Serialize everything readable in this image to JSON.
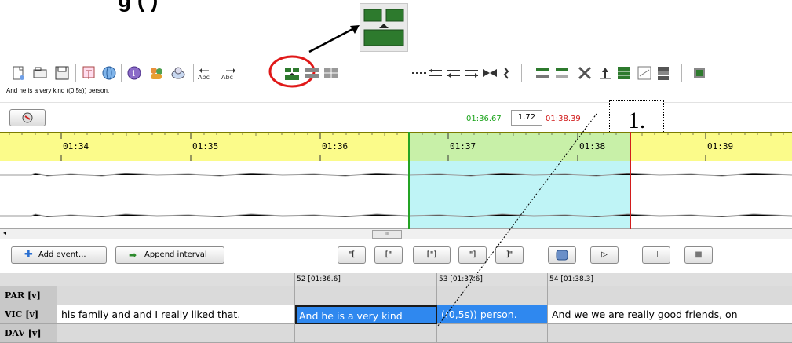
{
  "header": {
    "text": "g (         )"
  },
  "toolbar": {
    "icons": [
      "new-document",
      "open-folder",
      "save",
      "transcript",
      "globe",
      "info",
      "people",
      "search",
      "words-abc",
      "split",
      "merge",
      "grid",
      "arrow-join",
      "arrows-left",
      "arrows-right",
      "merge-arrows",
      "cursor-i",
      "insert-row",
      "remove-row",
      "cross",
      "up-arrow",
      "table",
      "chart",
      "stack",
      "end"
    ]
  },
  "transcript_line": "And he is a very kind ((0,5s)) person.",
  "selection": {
    "start": "01:36.67",
    "duration": "1.72",
    "end": "01:38.39"
  },
  "timeline": {
    "ticks": [
      "01:34",
      "01:35",
      "01:36",
      "01:37",
      "01:38",
      "01:39"
    ]
  },
  "callout": {
    "label": "1."
  },
  "scrollbar": {
    "thumb": "III"
  },
  "buttons": {
    "add_event": "Add event...",
    "append_interval": "Append interval",
    "play_start": "\"[",
    "play_open": "[\"",
    "play_sel": "[\"]",
    "play_before": "\"]",
    "play_close": "]\"",
    "play": "▷",
    "pause": "II",
    "stop": "■"
  },
  "tiers": {
    "columns": [
      "52 [01:36.6]",
      "53 [01:37.6]",
      "54 [01:38.3]"
    ],
    "rows": [
      {
        "name": "PAR [v]"
      },
      {
        "name": "VIC [v]",
        "cells": [
          "his family and and I really liked that.",
          "And he is a very kind",
          "((0,5s)) person.",
          "And we we are really good friends, on"
        ]
      },
      {
        "name": "DAV [v]"
      }
    ]
  },
  "colors": {
    "selection": "#bff4f6",
    "timeline": "#fbfb8a",
    "selected_event": "#2f88ef",
    "start_marker": "#24a324",
    "end_marker": "#d21c1c",
    "annotation_circle": "#e01818"
  }
}
